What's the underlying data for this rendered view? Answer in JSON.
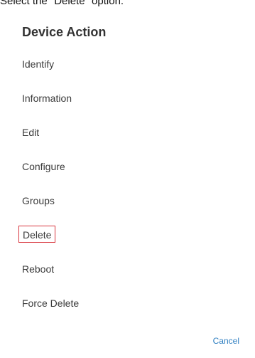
{
  "instruction": "Select the \"Delete\" option.",
  "dialog": {
    "title": "Device Action",
    "items": [
      {
        "label": "Identify"
      },
      {
        "label": "Information"
      },
      {
        "label": "Edit"
      },
      {
        "label": "Configure"
      },
      {
        "label": "Groups"
      },
      {
        "label": "Delete",
        "highlighted": true
      },
      {
        "label": "Reboot"
      },
      {
        "label": "Force Delete"
      }
    ],
    "cancel_label": "Cancel"
  },
  "colors": {
    "highlight_border": "#d9363e",
    "cancel_text": "#2f7fc1",
    "title_text": "#333333"
  }
}
